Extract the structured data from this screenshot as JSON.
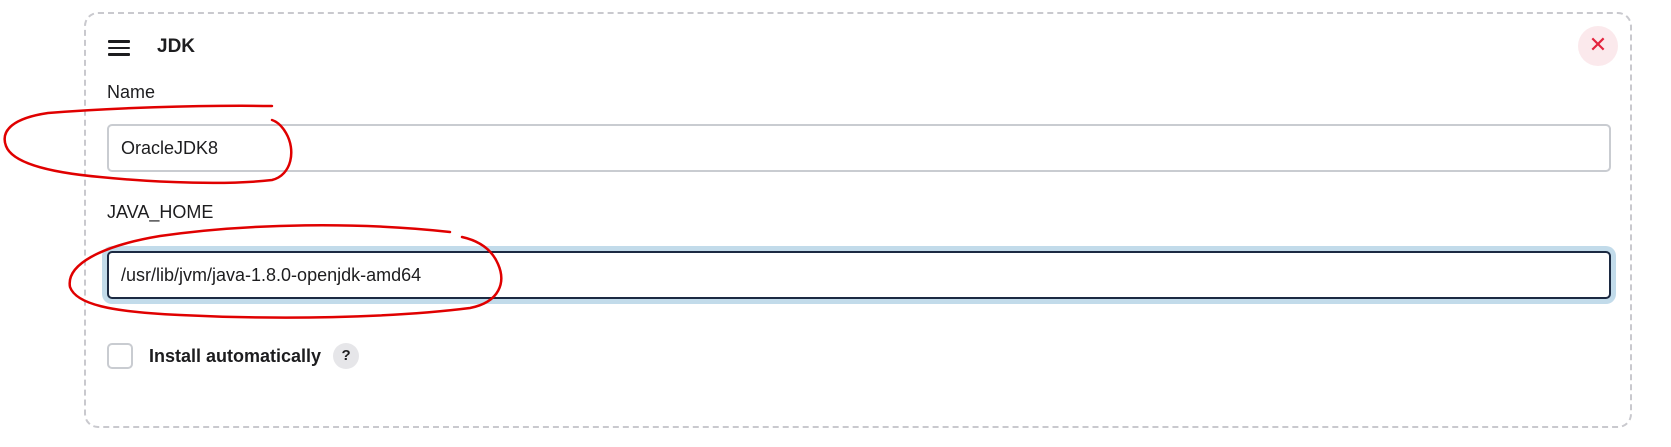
{
  "card": {
    "title": "JDK",
    "drag_icon": "menu-icon",
    "close_icon": "close-icon",
    "close_label": "✕"
  },
  "fields": {
    "name": {
      "label": "Name",
      "value": "OracleJDK8"
    },
    "java_home": {
      "label": "JAVA_HOME",
      "value": "/usr/lib/jvm/java-1.8.0-openjdk-amd64"
    }
  },
  "install": {
    "label": "Install automatically",
    "checked": false,
    "help_label": "?"
  },
  "colors": {
    "delete_bg": "#fbe9ec",
    "delete_fg": "#e3243e",
    "focus_ring": "#c2dbea",
    "focus_border": "#1c2a42",
    "annotation": "#e00000"
  }
}
